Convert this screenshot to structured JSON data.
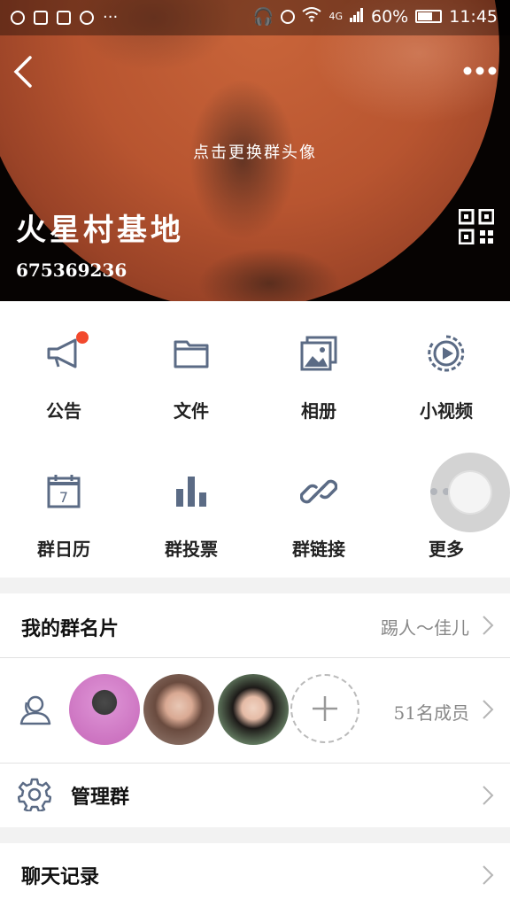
{
  "status_bar": {
    "network": "4G",
    "battery": "60%",
    "time": "11:45"
  },
  "header": {
    "change_avatar_hint": "点击更换群头像",
    "group_name": "火星村基地",
    "group_id": "675369236"
  },
  "features": [
    {
      "label": "公告",
      "icon": "megaphone-icon",
      "has_badge": true
    },
    {
      "label": "文件",
      "icon": "folder-icon"
    },
    {
      "label": "相册",
      "icon": "photo-album-icon"
    },
    {
      "label": "小视频",
      "icon": "video-icon"
    },
    {
      "label": "群日历",
      "icon": "calendar-icon",
      "date": "7"
    },
    {
      "label": "群投票",
      "icon": "poll-icon"
    },
    {
      "label": "群链接",
      "icon": "link-icon"
    },
    {
      "label": "更多",
      "icon": "more-icon"
    }
  ],
  "my_card": {
    "title": "我的群名片",
    "value": "踢人～佳儿"
  },
  "members": {
    "count_label": "51名成员"
  },
  "manage": {
    "title": "管理群"
  },
  "chat_history": {
    "title": "聊天记录"
  },
  "colors": {
    "icon": "#5b6b85",
    "badge": "#f2492d"
  }
}
